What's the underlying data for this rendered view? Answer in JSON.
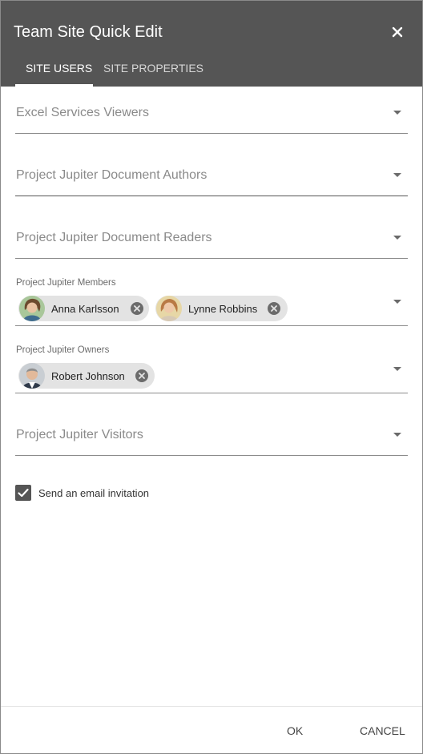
{
  "dialog": {
    "title": "Team Site Quick Edit",
    "close_icon": "close-icon"
  },
  "tabs": [
    {
      "label": "SITE USERS",
      "active": true
    },
    {
      "label": "SITE PROPERTIES",
      "active": false
    }
  ],
  "fields": {
    "excel_viewers": {
      "placeholder": "Excel Services Viewers"
    },
    "doc_authors": {
      "placeholder": "Project Jupiter Document Authors"
    },
    "doc_readers": {
      "placeholder": "Project Jupiter Document Readers"
    },
    "members": {
      "label": "Project Jupiter Members",
      "people": [
        {
          "name": "Anna Karlsson",
          "avatar": "person-avatar"
        },
        {
          "name": "Lynne Robbins",
          "avatar": "person-avatar"
        }
      ]
    },
    "owners": {
      "label": "Project Jupiter Owners",
      "people": [
        {
          "name": "Robert Johnson",
          "avatar": "person-avatar"
        }
      ]
    },
    "visitors": {
      "placeholder": "Project Jupiter Visitors"
    }
  },
  "email_invitation": {
    "label": "Send an email invitation",
    "checked": true
  },
  "footer": {
    "ok_label": "OK",
    "cancel_label": "CANCEL"
  },
  "colors": {
    "header_bg": "#555555",
    "chip_bg": "#e3e3e3",
    "checkbox_bg": "#555555"
  }
}
